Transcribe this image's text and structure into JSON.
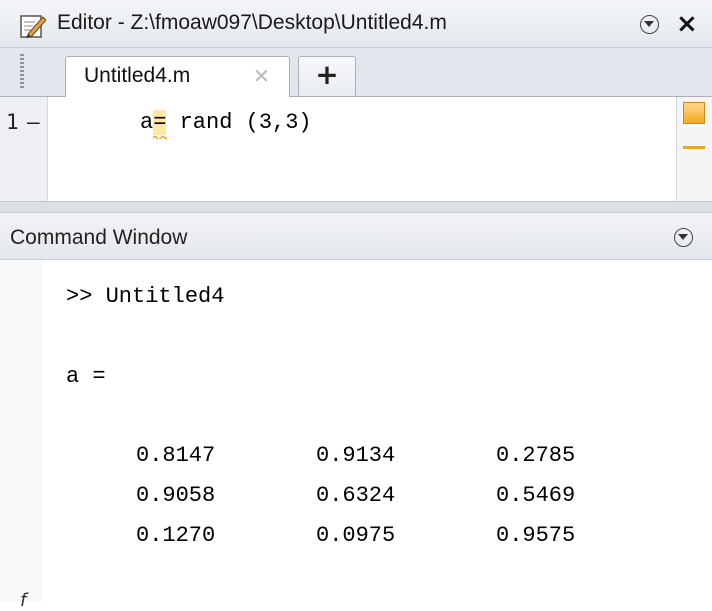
{
  "editor": {
    "title": "Editor - Z:\\fmoaw097\\Desktop\\Untitled4.m",
    "tab_label": "Untitled4.m",
    "tab_close": "✕",
    "add_tab": "+",
    "close": "×",
    "line_number": "1",
    "breakpoint_marker": "–",
    "code": {
      "var": "a",
      "op": "=",
      "rest": " rand (3,3)"
    }
  },
  "command_window": {
    "title": "Command Window",
    "command": ">> Untitled4",
    "var_label": "a =",
    "matrix": [
      [
        "0.8147",
        "0.9134",
        "0.2785"
      ],
      [
        "0.9058",
        "0.6324",
        "0.5469"
      ],
      [
        "0.1270",
        "0.0975",
        "0.9575"
      ]
    ],
    "prompt_glyph": "f"
  },
  "colors": {
    "highlight": "#ffe7a6",
    "warning": "#f0a32a"
  },
  "icons": {
    "editor": "editor-pencil-icon",
    "menu": "chevron-down-circle-icon",
    "close": "close-icon"
  }
}
